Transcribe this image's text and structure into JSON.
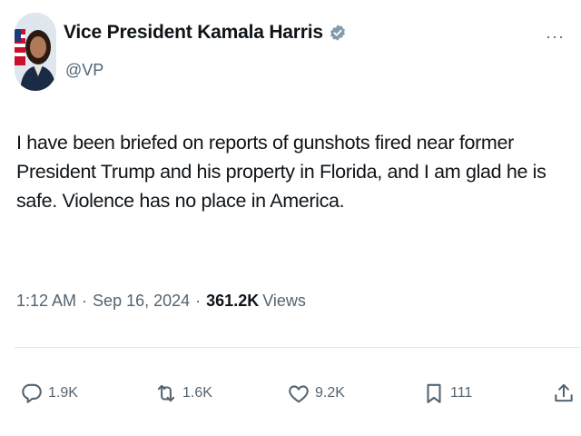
{
  "author": {
    "display_name": "Vice President Kamala Harris",
    "handle": "@VP",
    "verified_color": "#829aab"
  },
  "tweet": {
    "text": "I have been briefed on reports of gunshots fired near former President Trump and his property in Florida, and I am glad he is safe. Violence has no place in America.",
    "time": "1:12 AM",
    "separator1": "·",
    "date": "Sep 16, 2024",
    "separator2": "·",
    "views_count": "361.2K",
    "views_label": "Views"
  },
  "actions": {
    "replies": "1.9K",
    "reposts": "1.6K",
    "likes": "9.2K",
    "bookmarks": "111"
  },
  "menu": {
    "more_label": "···"
  },
  "icons": [
    "reply-icon",
    "repost-icon",
    "like-icon",
    "bookmark-icon",
    "share-icon",
    "verified-badge-icon",
    "more-icon"
  ],
  "colors": {
    "text": "#0f1419",
    "secondary": "#536471",
    "divider": "#e4e8eb"
  }
}
